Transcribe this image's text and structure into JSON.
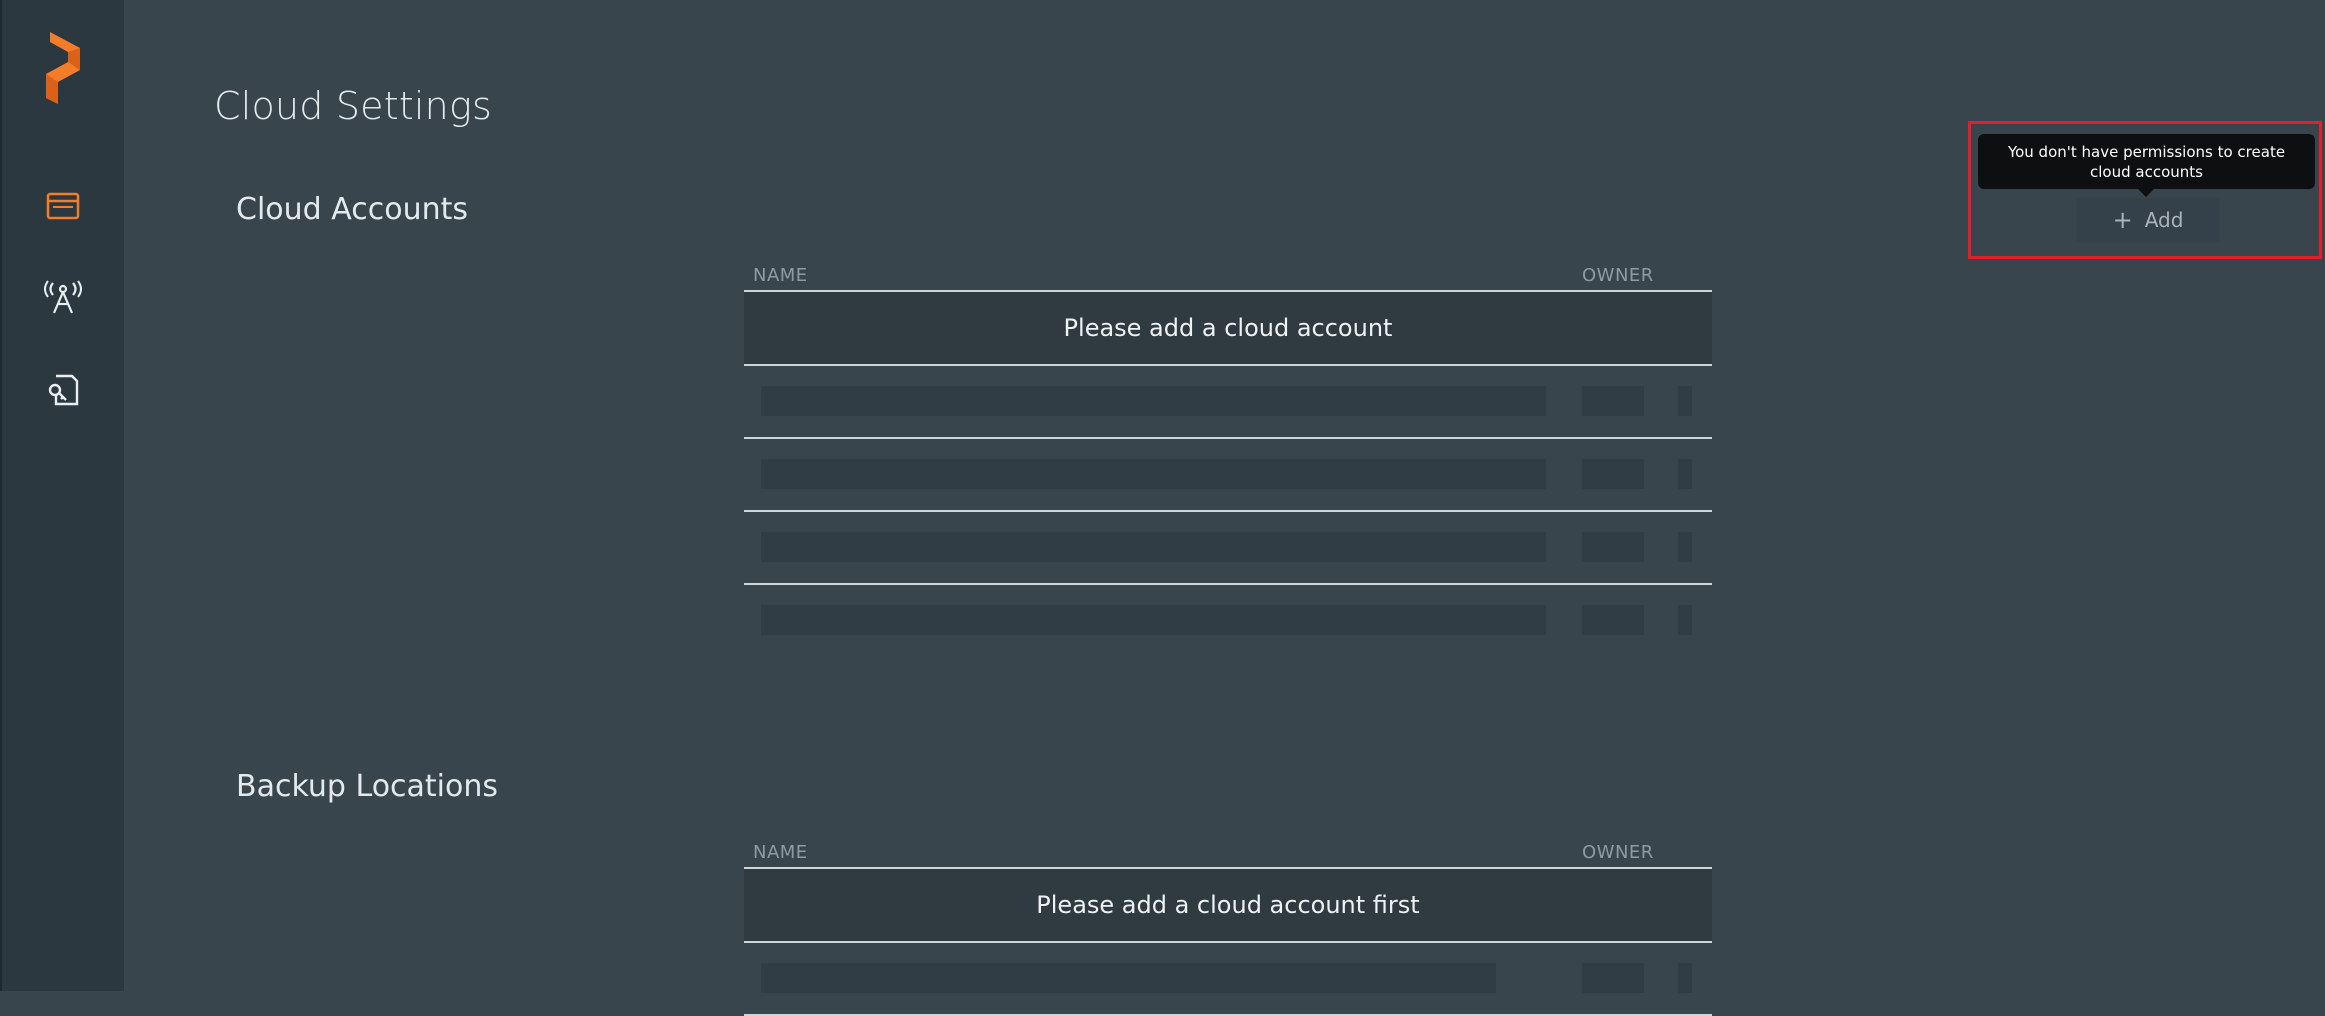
{
  "colors": {
    "accent": "#f57c28",
    "background": "#38454d",
    "sidebar": "#2c383f",
    "highlight": "#e0202e"
  },
  "sidebar": {
    "logo": "portworx-logo",
    "items": [
      {
        "icon": "dashboard-window-icon",
        "active": true
      },
      {
        "icon": "antenna-broadcast-icon",
        "active": false
      },
      {
        "icon": "document-key-icon",
        "active": false
      }
    ]
  },
  "page": {
    "title": "Cloud Settings"
  },
  "cloud_accounts": {
    "title": "Cloud Accounts",
    "columns": [
      "NAME",
      "OWNER"
    ],
    "empty_message": "Please add a cloud account",
    "add_button": {
      "label": "Add",
      "icon": "plus-icon",
      "tooltip": "You don't have permissions to create cloud accounts"
    }
  },
  "backup_locations": {
    "title": "Backup Locations",
    "columns": [
      "NAME",
      "OWNER"
    ],
    "empty_message": "Please add a cloud account first"
  }
}
